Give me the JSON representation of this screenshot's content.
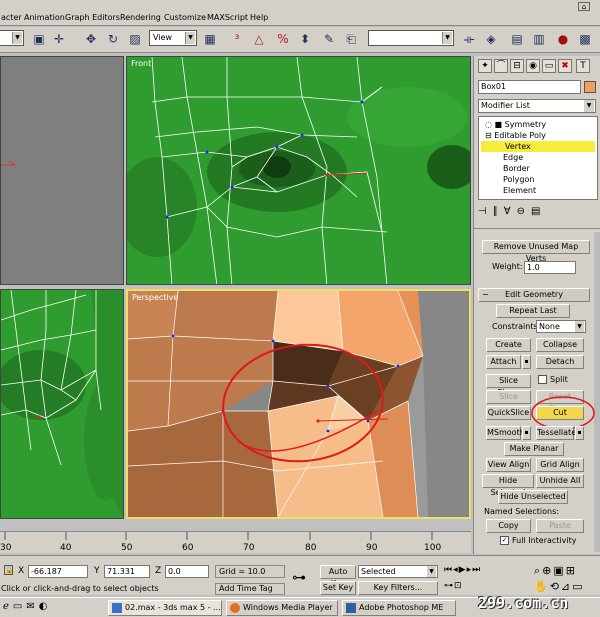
{
  "menu": {
    "items": [
      "acter",
      "Animation",
      "Graph Editors",
      "Rendering",
      "Customize",
      "MAXScript",
      "Help"
    ]
  },
  "toolbar": {
    "view_dropdown": "View",
    "named_sel_dropdown": ""
  },
  "viewports": {
    "front_label": "Front",
    "persp_label": "Perspective"
  },
  "panel": {
    "object_name": "Box01",
    "modifier_list": "Modifier List",
    "stack": [
      "Symmetry",
      "Editable Poly",
      "Vertex",
      "Edge",
      "Border",
      "Polygon",
      "Element"
    ],
    "selected_stack_item": "Vertex",
    "remove_unused": "Remove Unused Map Verts",
    "weight_label": "Weight:",
    "weight_value": "1.0",
    "rollout_title": "Edit Geometry",
    "repeat_last": "Repeat Last",
    "constraints_label": "Constraints:",
    "constraints_value": "None",
    "create": "Create",
    "collapse": "Collapse",
    "attach": "Attach",
    "detach": "Detach",
    "slice_plane": "Slice Plane",
    "split": "Split",
    "slice": "Slice",
    "reset_plane": "Reset Plane",
    "quickslice": "QuickSlice",
    "cut": "Cut",
    "msmooth": "MSmooth",
    "tessellate": "Tessellate",
    "make_planar": "Make Planar",
    "view_align": "View Align",
    "grid_align": "Grid Align",
    "hide_selected": "Hide Selected",
    "unhide_all": "Unhide All",
    "hide_unselected": "Hide Unselected",
    "named_selections": "Named Selections:",
    "copy": "Copy",
    "paste": "Paste",
    "full_interactivity": "Full Interactivity"
  },
  "ruler": {
    "ticks": [
      "30",
      "40",
      "50",
      "60",
      "70",
      "80",
      "90",
      "100"
    ]
  },
  "status": {
    "x_label": "X",
    "x_value": "-66.187",
    "y_label": "Y",
    "y_value": "71.331",
    "z_label": "Z",
    "z_value": "0.0",
    "grid": "Grid = 10.0",
    "auto_key": "Auto Key",
    "selected": "Selected",
    "set_key": "Set Key",
    "key_filters": "Key Filters...",
    "add_time_tag": "Add Time Tag",
    "prompt": "Click or click-and-drag to select objects"
  },
  "taskbar": {
    "items": [
      "02.max - 3ds max 5 - ...",
      "Windows Media Player",
      "Adobe Photoshop ME"
    ],
    "watermark": "299.com.cn"
  },
  "colors": {
    "accent_highlight": "#f7ec3a",
    "cut_button": "#f3d64c",
    "annotation_circle": "#e02020",
    "wire": "#ffffff"
  }
}
